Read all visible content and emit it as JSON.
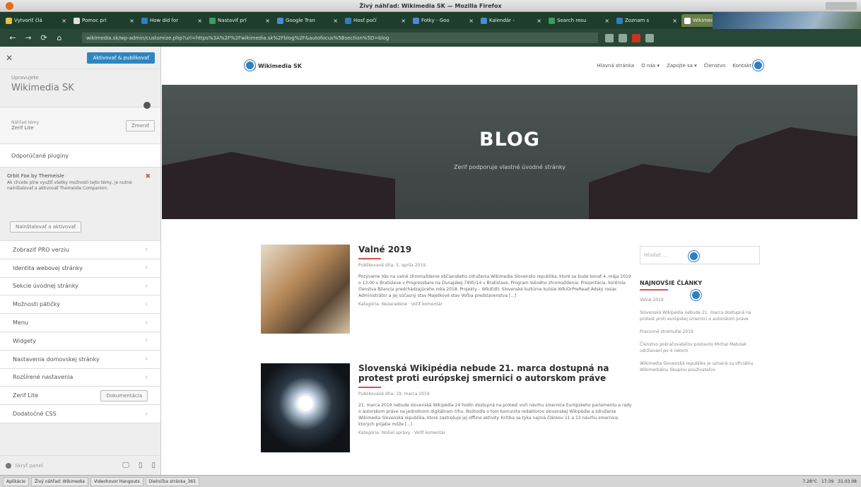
{
  "window": {
    "title": "Živý náhľad: Wikimedia SK — Mozilla Firefox"
  },
  "tabs": [
    {
      "label": "Vytvoriť člá",
      "color": "#e8c04a"
    },
    {
      "label": "Pomoc pri",
      "color": "#e0e0e0"
    },
    {
      "label": "How did for",
      "color": "#2f7fc1"
    },
    {
      "label": "Nastaviť prí",
      "color": "#3a9d5d"
    },
    {
      "label": "Google Tran",
      "color": "#4a8bd6"
    },
    {
      "label": "Hosť počí",
      "color": "#2f7fc1"
    },
    {
      "label": "Fotky - Goo",
      "color": "#4a8bd6"
    },
    {
      "label": "Kalendár -",
      "color": "#4a8bd6"
    },
    {
      "label": "Search resu",
      "color": "#3a9d5d"
    },
    {
      "label": "Zoznam s",
      "color": "#2f7fc1"
    },
    {
      "label": "Wikimedia SK",
      "color": "#ffffff"
    }
  ],
  "url": "wikimedia.sk/wp-admin/customize.php?url=https%3A%2F%2Fwikimedia.sk%2Fblog%2F&autofocus%5Bsection%5D=blog",
  "customizer": {
    "publish_label": "Aktivovať & publikovať",
    "previewing_label": "Upravujete",
    "site_title": "Wikimedia SK",
    "active_theme_label": "Náhľad témy",
    "active_theme_value": "Zerif Lite",
    "change_label": "Zmeniť",
    "recommended_label": "Odporúčané pluginy",
    "notice_title": "Orbit Fox by Themeisle",
    "notice_text": "Ak chcete plne využiť všetky možnosti tejto témy, je nutné nainštalovať a aktivovať Themeisle Companion.",
    "notice_button": "Nainštalovať a aktivovať",
    "menu_items": [
      "Zobraziť PRO verziu",
      "Identita webovej stránky",
      "Sekcie úvodnej stránky",
      "Možnosti pätičky",
      "Menu",
      "Widgety",
      "Nastavenia domovskej stránky",
      "Rozšírené nastavenia",
      "Zerif Lite",
      "Dodatočné CSS"
    ],
    "documentation_label": "Dokumentácia",
    "hide_controls": "Skryť panel"
  },
  "site": {
    "logo_text": "Wikimedia SK",
    "menu": [
      "Hlavná stránka",
      "O nás ▾",
      "Zapojte sa ▾",
      "Členstvo",
      "Kontakt"
    ],
    "hero_title": "BLOG",
    "hero_tagline": "Zerif podporuje vlastné úvodné stránky"
  },
  "posts": [
    {
      "title": "Valné 2019",
      "meta": "Publikované dňa: 5. apríla 2019",
      "excerpt": "Pozývame Vás na valné zhromaždenie občianskeho združenia Wikimedia Slovensko republika, ktoré sa bude konať 4. mája 2019 o 13:00 v Bratislave v Progressbare na Dunajskej 7495/14 v Bratislave. Program Valného zhromaždenia: Prezentácia, kontrola členstva Bilancia predchádzajúceho roka 2018. Projekty – WikiEdit: Slovenské kultúrne kulisie WikiOrPreRead Ádský rosiar. Administrátor a jej súčasný stav Majetkové stav Voľba predstavenstva [...]",
      "category": "Kategória: Nezaradené · Voľiť komentár"
    },
    {
      "title": "Slovenská Wikipédia nebude 21. marca dostupná na protest proti európskej smernici o autorskom práve",
      "meta": "Publikované dňa: 19. marca 2019",
      "excerpt": "21. marca 2019 nebude slovenská Wikipédia 24 hodín dostupná na protest voči návrhu smernice Európskeho parlamentu a rady o autorskom práve na jednotnom digitálnom trhu. Rozhodla o tom komunita redaktorov slovenskej Wikipédie a združenie Wikimedia Slovenská republika, ktoré zastrešuje jej offline aktivity. Kritika sa týka najmä článkov 11 a 13 návrhu smernice, ktorých prijatie môže [...]",
      "category": "Kategória: Nošiel správy · Voľiť komentár"
    }
  ],
  "sidebar_widgets": {
    "search_placeholder": "Hľadať ...",
    "recent_title": "NAJNOVŠIE ČLÁNKY",
    "recent_items": [
      "Valné 2019",
      "Slovenská Wikipédia nebude 21. marca dostupná na protest proti európskej smernici o autorskom práve",
      "Pracovné stretnutie 2019",
      "Členstvo pokračovateľov postavilo Michal Matulak udržiavaní po 4 rokoch",
      "Wikimedia Slovenská republika je uznaná za oficiálnu Wikimediálnu Skupinu používateľov"
    ]
  },
  "taskbar": {
    "items": [
      "Aplikácie",
      "Živý náhľad: Wikimedia",
      "Videohovor Hangouts",
      "Dielnička stránka_365"
    ],
    "temp": "7.28°C",
    "clock": "17:39",
    "date": "31.03.08"
  },
  "colors": {
    "accent": "#2f7fc1",
    "underline": "#d9534f",
    "publish": "#2e86c1"
  }
}
